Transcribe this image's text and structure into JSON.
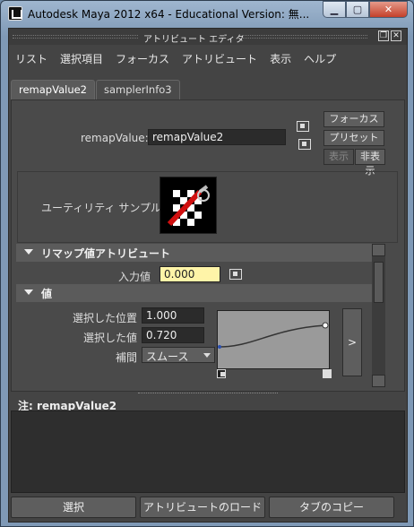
{
  "window": {
    "title": "Autodesk Maya 2012 x64 - Educational Version: 無..."
  },
  "panel": {
    "title": "アトリビュート エディタ"
  },
  "menubar": [
    "リスト",
    "選択項目",
    "フォーカス",
    "アトリビュート",
    "表示",
    "ヘルプ"
  ],
  "tabs": [
    {
      "label": "remapValue2",
      "active": true
    },
    {
      "label": "samplerInfo3",
      "active": false
    }
  ],
  "node": {
    "label": "remapValue:",
    "value": "remapValue2"
  },
  "side_buttons": {
    "focus": "フォーカス",
    "preset": "プリセット",
    "show": "表示",
    "hide": "非表示"
  },
  "swatch": {
    "label": "ユーティリティ サンプル"
  },
  "sections": {
    "remap_attrs": "リマップ値アトリビュート",
    "value": "値"
  },
  "input_value": {
    "label": "入力値",
    "value": "0.000"
  },
  "value_ramp": {
    "selected_position_label": "選択した位置",
    "selected_position": "1.000",
    "selected_value_label": "選択した値",
    "selected_value": "0.720",
    "interp_label": "補間",
    "interp_value": "スムース",
    "ramp_button": ">"
  },
  "note": {
    "text": "注:  remapValue2"
  },
  "bottom_buttons": {
    "select": "選択",
    "load_attrs": "アトリビュートのロード",
    "copy_tab": "タブのコピー"
  },
  "colors": {
    "panel_bg": "#444444",
    "field_bg": "#2b2b2b",
    "highlight_field": "#fff4a8"
  }
}
